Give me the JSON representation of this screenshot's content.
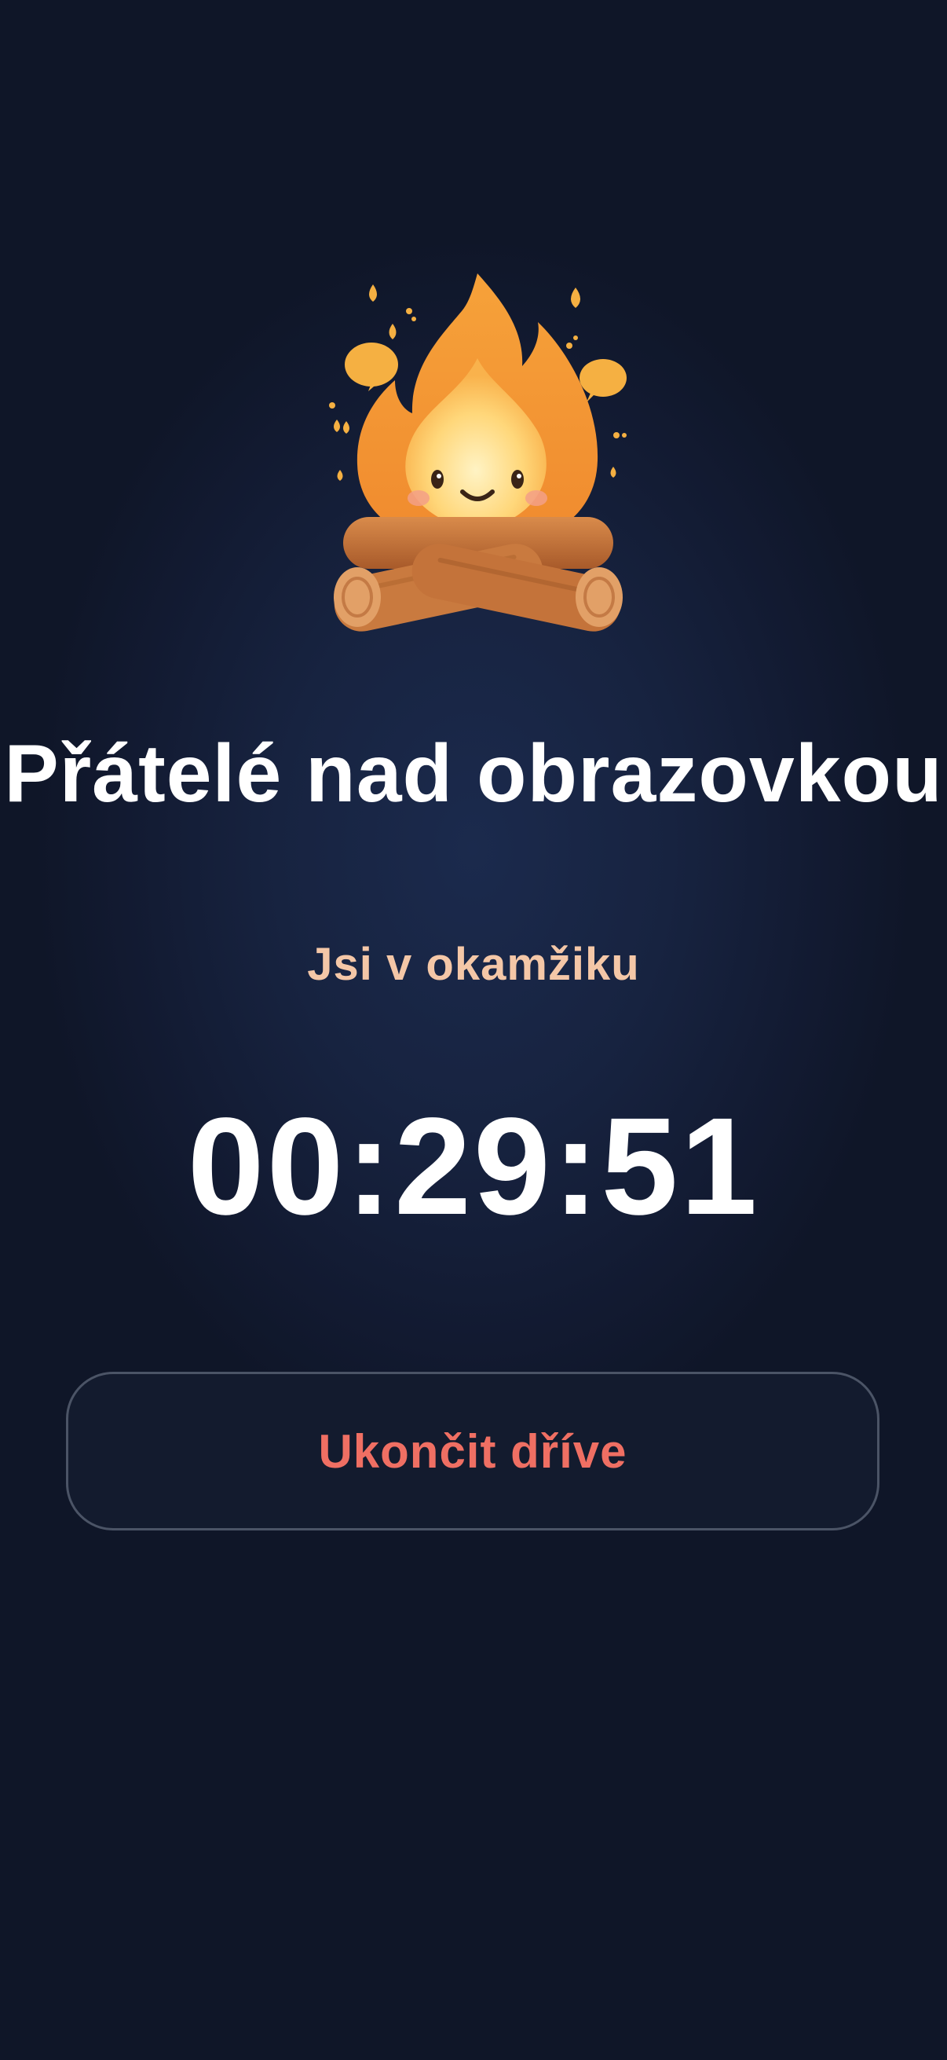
{
  "campfire": {
    "icon": "campfire-mascot-icon"
  },
  "session": {
    "title": "Přátelé nad obrazovkou",
    "status": "Jsi v okamžiku",
    "timer": "00:29:51"
  },
  "actions": {
    "end_early_label": "Ukončit dříve"
  },
  "colors": {
    "background": "#121a31",
    "title": "#ffffff",
    "subtitle": "#f4c7a7",
    "end_button_text": "#ef6f63",
    "end_button_border": "#4b5466"
  }
}
